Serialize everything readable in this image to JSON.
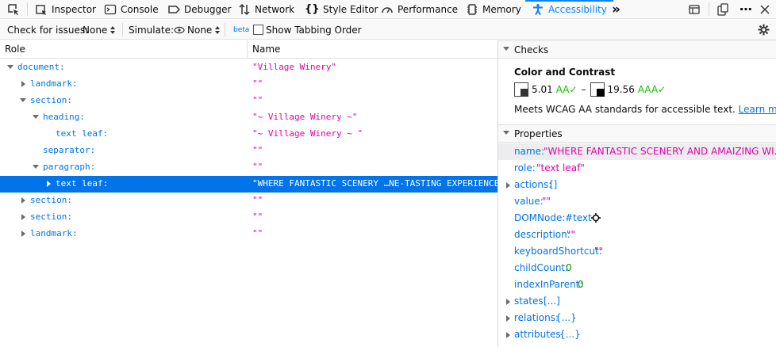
{
  "toolbar": {
    "tabs": [
      {
        "label": "Inspector",
        "icon": "inspector-icon"
      },
      {
        "label": "Console",
        "icon": "console-icon"
      },
      {
        "label": "Debugger",
        "icon": "debugger-icon"
      },
      {
        "label": "Network",
        "icon": "network-icon"
      },
      {
        "label": "Style Editor",
        "icon": "style-editor-icon"
      },
      {
        "label": "Performance",
        "icon": "performance-icon"
      },
      {
        "label": "Memory",
        "icon": "memory-icon"
      },
      {
        "label": "Accessibility",
        "icon": "accessibility-icon",
        "selected": true
      }
    ],
    "overflow_icon": "double-chevron-icon",
    "right_icons": [
      "responsive-design-icon",
      "dock-icon",
      "more-icon",
      "close-icon"
    ],
    "accent_color": "#0a84ff"
  },
  "subbar": {
    "check_label": "Check for issues:",
    "check_value": "None",
    "simulate_label": "Simulate:",
    "simulate_value": "None",
    "beta": "beta",
    "tabbing_label": "Show Tabbing Order",
    "settings_icon": "gear-icon"
  },
  "tree": {
    "col_role": "Role",
    "col_name": "Name",
    "rows": [
      {
        "role": "document:",
        "name": "\"Village Winery\"",
        "depth": 0,
        "twisty": "open"
      },
      {
        "role": "landmark:",
        "name": "\"\"",
        "depth": 1,
        "twisty": "closed"
      },
      {
        "role": "section:",
        "name": "\"\"",
        "depth": 1,
        "twisty": "open"
      },
      {
        "role": "heading:",
        "name": "\"~ Village Winery ~\"",
        "depth": 2,
        "twisty": "open"
      },
      {
        "role": "text leaf:",
        "name": "\"~ Village Winery ~ \"",
        "depth": 3,
        "twisty": "none"
      },
      {
        "role": "separator:",
        "name": "\"\"",
        "depth": 2,
        "twisty": "none"
      },
      {
        "role": "paragraph:",
        "name": "\"\"",
        "depth": 2,
        "twisty": "open"
      },
      {
        "role": "text leaf:",
        "name": "\"WHERE FANTASTIC SCENERY …NE-TASTING EXPERIENCE. \"",
        "depth": 3,
        "twisty": "closed",
        "selected": true
      },
      {
        "role": "section:",
        "name": "\"\"",
        "depth": 1,
        "twisty": "closed"
      },
      {
        "role": "section:",
        "name": "\"\"",
        "depth": 1,
        "twisty": "closed"
      },
      {
        "role": "landmark:",
        "name": "\"\"",
        "depth": 1,
        "twisty": "closed"
      }
    ]
  },
  "checks": {
    "title": "Checks",
    "subtitle": "Color and Contrast",
    "ratio_min": "5.01",
    "grade_min": "AA✓",
    "dash": "–",
    "ratio_max": "19.56",
    "grade_max": "AAA✓",
    "description": "Meets WCAG AA standards for accessible text.",
    "learn_more": "Learn more"
  },
  "properties": {
    "title": "Properties",
    "items": [
      {
        "key": "name:",
        "value": "\"WHERE FANTASTIC SCENERY AND AMAIZING WI...",
        "type": "str",
        "highlighted": true
      },
      {
        "key": "role:",
        "value": "\"text leaf\"",
        "type": "str"
      },
      {
        "key": "actions:",
        "value": "[]",
        "type": "obj",
        "twisty": true
      },
      {
        "key": "value:",
        "value": "\"\"",
        "type": "str"
      },
      {
        "key": "DOMNode:",
        "value": "#text",
        "type": "obj",
        "icon": "target-icon"
      },
      {
        "key": "description:",
        "value": "\"\"",
        "type": "str"
      },
      {
        "key": "keyboardShortcut:",
        "value": "\"\"",
        "type": "str"
      },
      {
        "key": "childCount:",
        "value": "0",
        "type": "num"
      },
      {
        "key": "indexInParent:",
        "value": "0",
        "type": "num"
      },
      {
        "key": "states:",
        "value": "[...]",
        "type": "obj",
        "twisty": true
      },
      {
        "key": "relations:",
        "value": "{...}",
        "type": "obj",
        "twisty": true
      },
      {
        "key": "attributes:",
        "value": "{...}",
        "type": "obj",
        "twisty": true
      }
    ]
  }
}
